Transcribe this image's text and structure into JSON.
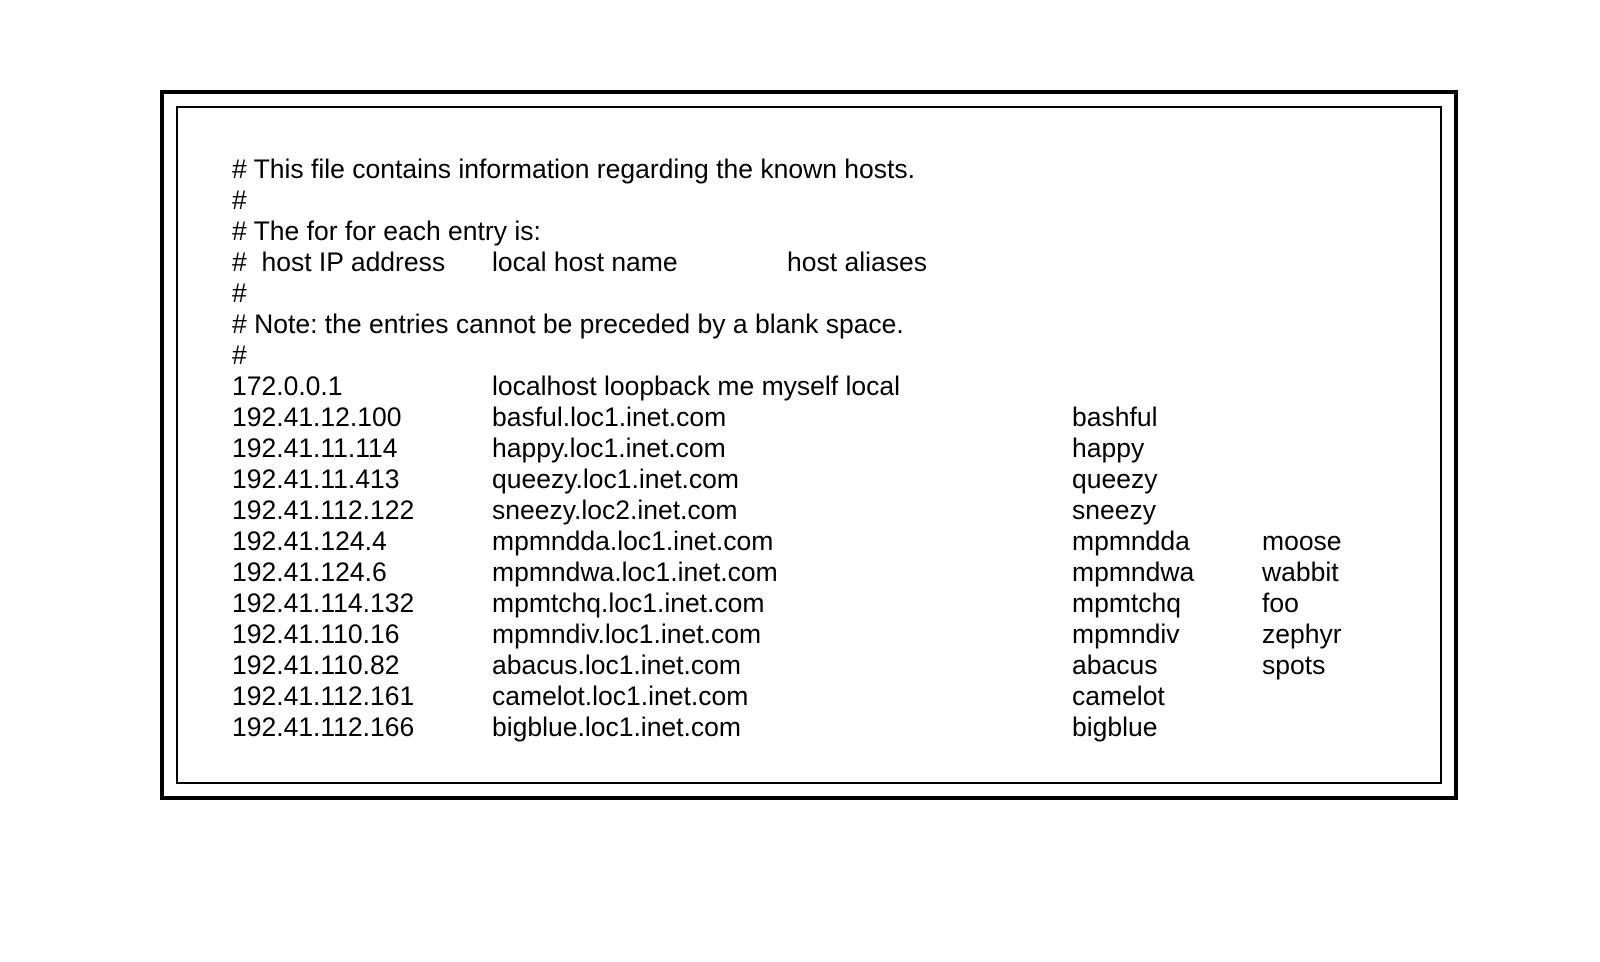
{
  "comments": {
    "l1": "# This file contains information regarding the known hosts.",
    "l2": "#",
    "l3": "# The for for each entry is:",
    "l5": "#",
    "l6": "# Note: the entries cannot be preceded by a blank space.",
    "l7": "#"
  },
  "header": {
    "ip": "#  host IP address",
    "name": "local host name",
    "alias": "host aliases"
  },
  "entries": [
    {
      "ip": "172.0.0.1",
      "name": "localhost loopback me myself local",
      "a1": "",
      "a2": ""
    },
    {
      "ip": "192.41.12.100",
      "name": "basful.loc1.inet.com",
      "a1": "bashful",
      "a2": ""
    },
    {
      "ip": "192.41.11.114",
      "name": "happy.loc1.inet.com",
      "a1": "happy",
      "a2": ""
    },
    {
      "ip": "192.41.11.413",
      "name": "queezy.loc1.inet.com",
      "a1": "queezy",
      "a2": ""
    },
    {
      "ip": "192.41.112.122",
      "name": "sneezy.loc2.inet.com",
      "a1": "sneezy",
      "a2": ""
    },
    {
      "ip": "192.41.124.4",
      "name": "mpmndda.loc1.inet.com",
      "a1": "mpmndda",
      "a2": "moose"
    },
    {
      "ip": "192.41.124.6",
      "name": "mpmndwa.loc1.inet.com",
      "a1": "mpmndwa",
      "a2": "wabbit"
    },
    {
      "ip": "192.41.114.132",
      "name": "mpmtchq.loc1.inet.com",
      "a1": "mpmtchq",
      "a2": "foo"
    },
    {
      "ip": "192.41.110.16",
      "name": "mpmndiv.loc1.inet.com",
      "a1": "mpmndiv",
      "a2": "zephyr"
    },
    {
      "ip": "192.41.110.82",
      "name": "abacus.loc1.inet.com",
      "a1": "abacus",
      "a2": "spots"
    },
    {
      "ip": "192.41.112.161",
      "name": "camelot.loc1.inet.com",
      "a1": "camelot",
      "a2": ""
    },
    {
      "ip": "192.41.112.166",
      "name": "bigblue.loc1.inet.com",
      "a1": "bigblue",
      "a2": ""
    }
  ]
}
